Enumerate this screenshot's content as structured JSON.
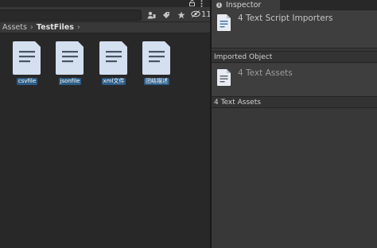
{
  "project": {
    "header_icons": [
      "lock-icon",
      "kebab-menu-icon"
    ],
    "toolbar": {
      "search_value": "",
      "buttons": [
        "create-filter-icon",
        "label-filter-icon",
        "favorite-icon"
      ],
      "hidden_count": "11"
    },
    "breadcrumb": [
      "Assets",
      "TestFiles"
    ],
    "assets": [
      {
        "name": "csvfile"
      },
      {
        "name": "jsonfile"
      },
      {
        "name": "xml文件"
      },
      {
        "name": "团结描述"
      }
    ],
    "selection_color": "#2c5d87"
  },
  "inspector": {
    "tab_label": "Inspector",
    "header_title": "4 Text Script Importers",
    "section_imported": "Imported Object",
    "imported_title": "4 Text Assets",
    "section_assets": "4 Text Assets"
  }
}
